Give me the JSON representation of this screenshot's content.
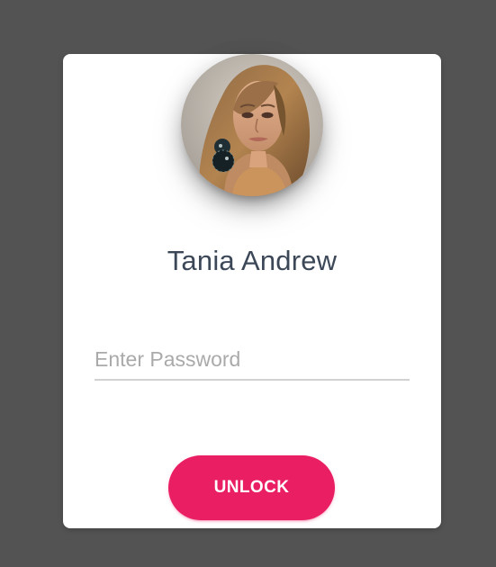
{
  "lock_screen": {
    "user_name": "Tania Andrew",
    "password_placeholder": "Enter Password",
    "password_value": "",
    "unlock_label": "UNLOCK"
  },
  "colors": {
    "page_background": "#535353",
    "card_background": "#ffffff",
    "name_text": "#3c4858",
    "accent": "#e91e63",
    "underline": "#d2d2d2",
    "placeholder": "#aaaaaa"
  },
  "icons": {
    "avatar": "user-avatar-photo"
  }
}
